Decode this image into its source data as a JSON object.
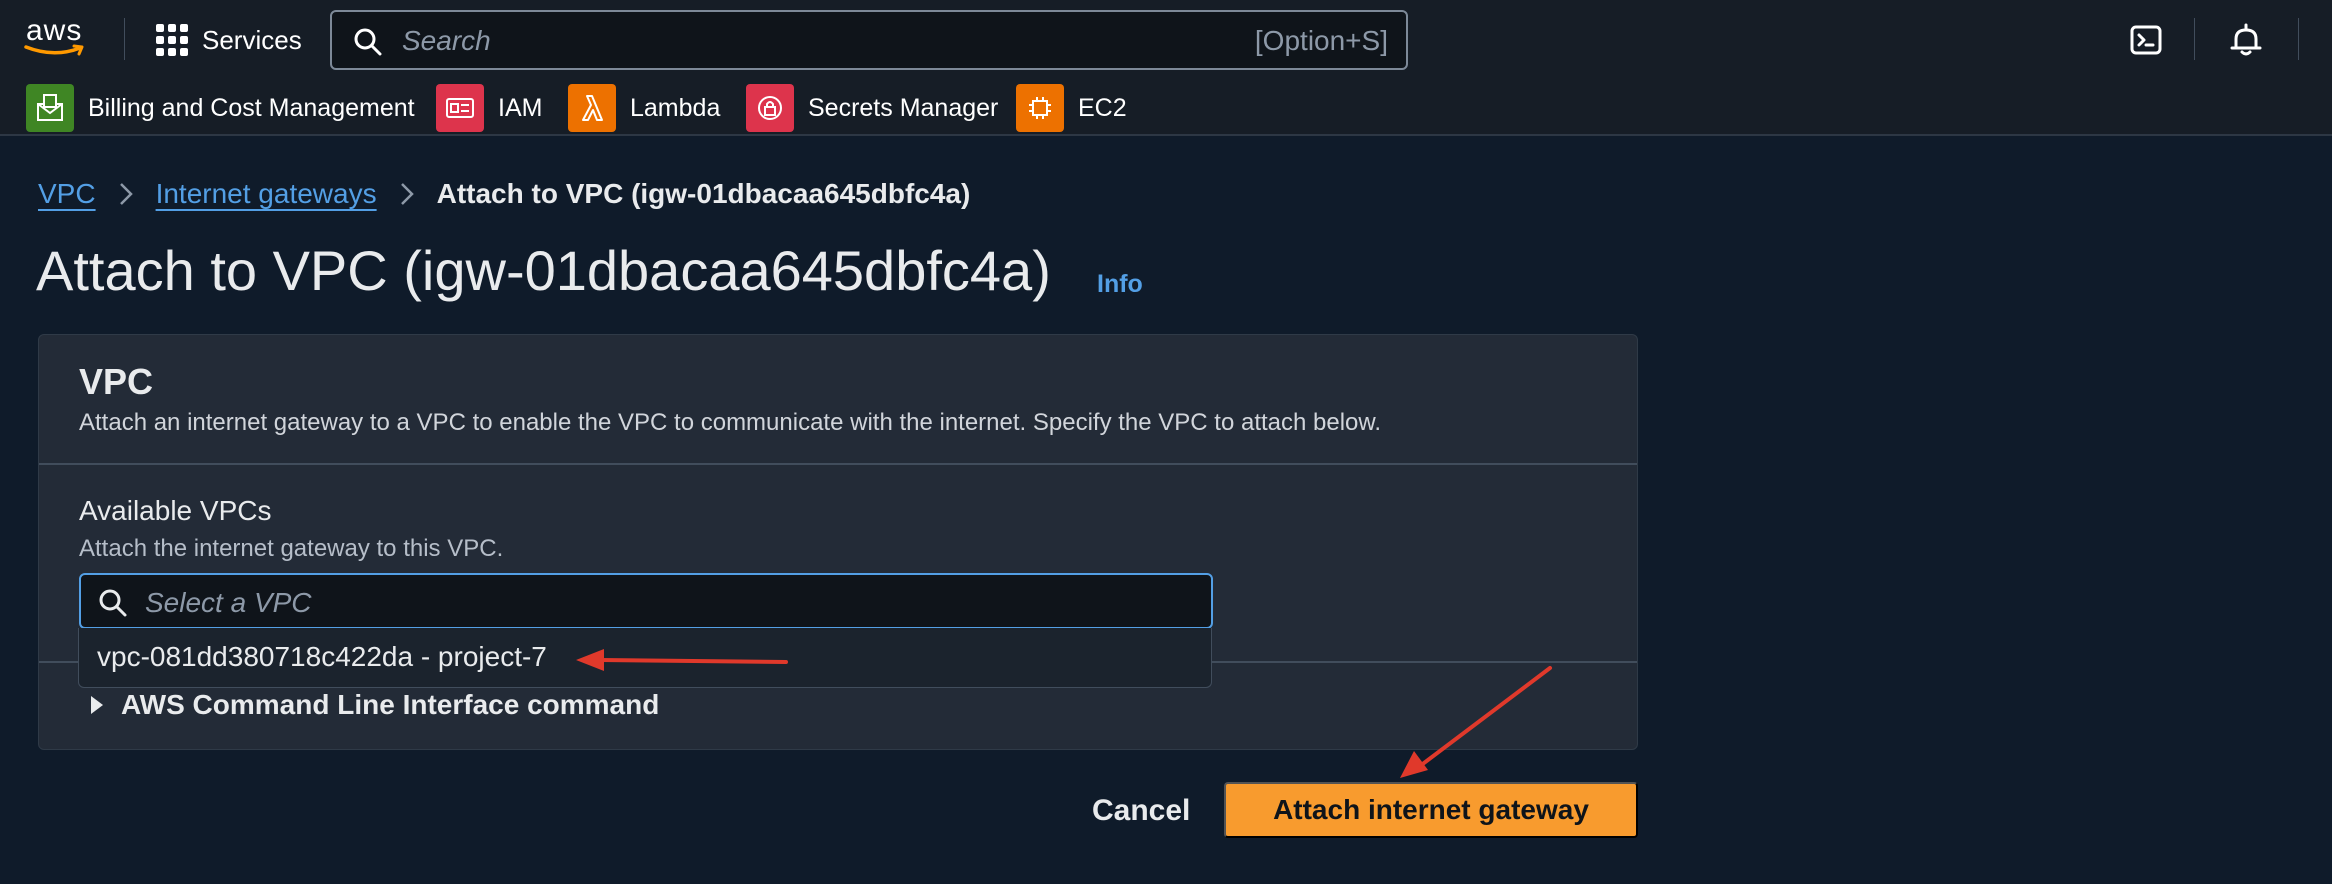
{
  "topbar": {
    "logo_text": "aws",
    "services_label": "Services",
    "search_placeholder": "Search",
    "search_shortcut": "[Option+S]"
  },
  "favorites": [
    {
      "label": "Billing and Cost Management",
      "icon": "billing-icon",
      "color": "#3f8624"
    },
    {
      "label": "IAM",
      "icon": "iam-icon",
      "color": "#dd344c"
    },
    {
      "label": "Lambda",
      "icon": "lambda-icon",
      "color": "#ed7100"
    },
    {
      "label": "Secrets Manager",
      "icon": "secrets-manager-icon",
      "color": "#dd344c"
    },
    {
      "label": "EC2",
      "icon": "ec2-icon",
      "color": "#ed7100"
    }
  ],
  "breadcrumb": {
    "items": [
      "VPC",
      "Internet gateways"
    ],
    "current": "Attach to VPC (igw-01dbacaa645dbfc4a)"
  },
  "page": {
    "title": "Attach to VPC (igw-01dbacaa645dbfc4a)",
    "info_label": "Info"
  },
  "panel": {
    "title": "VPC",
    "description": "Attach an internet gateway to a VPC to enable the VPC to communicate with the internet. Specify the VPC to attach below.",
    "field_label": "Available VPCs",
    "field_description": "Attach the internet gateway to this VPC.",
    "input_placeholder": "Select a VPC",
    "options": [
      "vpc-081dd380718c422da - project-7"
    ],
    "cli_label": "AWS Command Line Interface command"
  },
  "actions": {
    "cancel_label": "Cancel",
    "primary_label": "Attach internet gateway"
  },
  "colors": {
    "background": "#0f1b2a",
    "nav": "#161d26",
    "link": "#539fe5",
    "primary": "#f89b2e",
    "annotation_arrow": "#e0392b"
  }
}
